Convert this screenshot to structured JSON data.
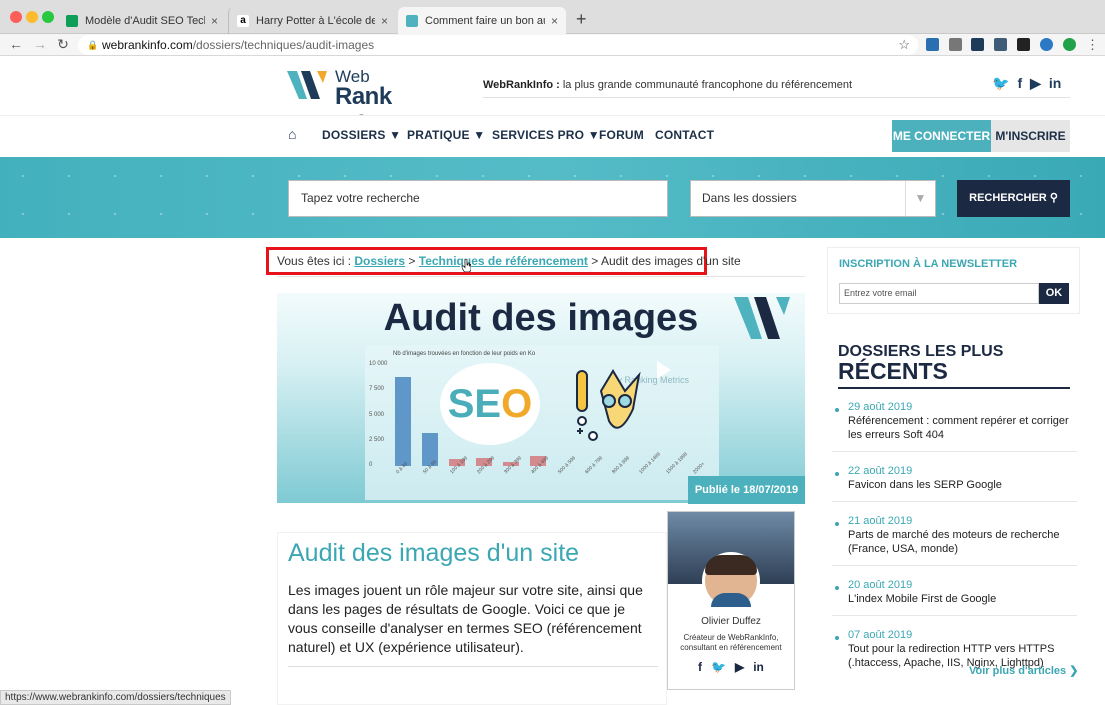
{
  "browser": {
    "tabs": [
      {
        "title": "Modèle d'Audit SEO Technique",
        "close": "×"
      },
      {
        "title": "Harry Potter à L'école des Sorciers",
        "close": "×"
      },
      {
        "title": "Comment faire un bon audit des images",
        "close": "×"
      }
    ],
    "new_tab": "+",
    "url_host": "webrankinfo.com",
    "url_path": "/dossiers/techniques/audit-images",
    "status_url": "https://www.webrankinfo.com/dossiers/techniques"
  },
  "header": {
    "logo_line1": "Web",
    "logo_line2": "Rank Info",
    "tagline_brand": "WebRankInfo :",
    "tagline_text": " la plus grande communauté francophone du référencement",
    "social": [
      "twitter-icon",
      "facebook-icon",
      "youtube-icon",
      "linkedin-icon"
    ]
  },
  "nav": {
    "home_icon": "⌂",
    "items": [
      "DOSSIERS ▼",
      "PRATIQUE ▼",
      "SERVICES PRO ▼",
      "FORUM",
      "CONTACT"
    ],
    "connect": "ME CONNECTER",
    "signup": "M'INSCRIRE"
  },
  "search": {
    "placeholder": "Tapez votre recherche",
    "scope": "Dans les dossiers",
    "button": "RECHERCHER"
  },
  "breadcrumb": {
    "prefix": "Vous êtes ici : ",
    "crumb1": "Dossiers",
    "sep": " > ",
    "crumb2": "Techniques de référencement",
    "current": "Audit des images d'un site"
  },
  "feature": {
    "title": "Audit des images",
    "chart_title": "Nb d'images trouvées en fonction de leur poids en Ko",
    "y_ticks": [
      "10 000",
      "7 500",
      "5 000",
      "2 500",
      "0"
    ],
    "x_ticks": [
      "0 à 49",
      "50 à 99",
      "100 à 199",
      "200 à 299",
      "300 à 399",
      "400 à 499",
      "500 à 599",
      "600 à 799",
      "800 à 999",
      "1000 à 1499",
      "1500 à 1999",
      "2000+"
    ],
    "values": [
      8800,
      3300,
      700,
      750,
      400,
      950,
      0,
      0,
      0,
      0,
      0,
      0
    ],
    "seo_text1": "SE",
    "seo_text2": "O",
    "watermark": "My Ranking Metrics",
    "published": "Publié le 18/07/2019"
  },
  "article": {
    "title": "Audit des images d'un site",
    "intro": "Les images jouent un rôle majeur sur votre site, ainsi que dans les pages de résultats de Google. Voici ce que je vous conseille d'analyser en termes SEO (référencement naturel) et UX (expérience utilisateur)."
  },
  "author": {
    "name": "Olivier Duffez",
    "desc": "Créateur de WebRankInfo, consultant en référencement"
  },
  "newsletter": {
    "title": "INSCRIPTION À LA NEWSLETTER",
    "placeholder": "Entrez votre email",
    "button": "OK"
  },
  "recent": {
    "title1": "DOSSIERS LES PLUS",
    "title2": "RÉCENTS",
    "items": [
      {
        "date": "29 août 2019",
        "text": "Référencement : comment repérer et corriger les erreurs Soft 404"
      },
      {
        "date": "22 août 2019",
        "text": "Favicon dans les SERP Google"
      },
      {
        "date": "21 août 2019",
        "text": "Parts de marché des moteurs de recherche (France, USA, monde)"
      },
      {
        "date": "20 août 2019",
        "text": "L'index Mobile First de Google"
      },
      {
        "date": "07 août 2019",
        "text": "Tout pour la redirection HTTP vers HTTPS (.htaccess, Apache, IIS, Nginx, Lighttpd)"
      }
    ],
    "more": "Voir plus d'articles ❯"
  },
  "colors": {
    "teal": "#4cb1bd",
    "navy": "#1c2942",
    "highlight": "#e8131a"
  }
}
